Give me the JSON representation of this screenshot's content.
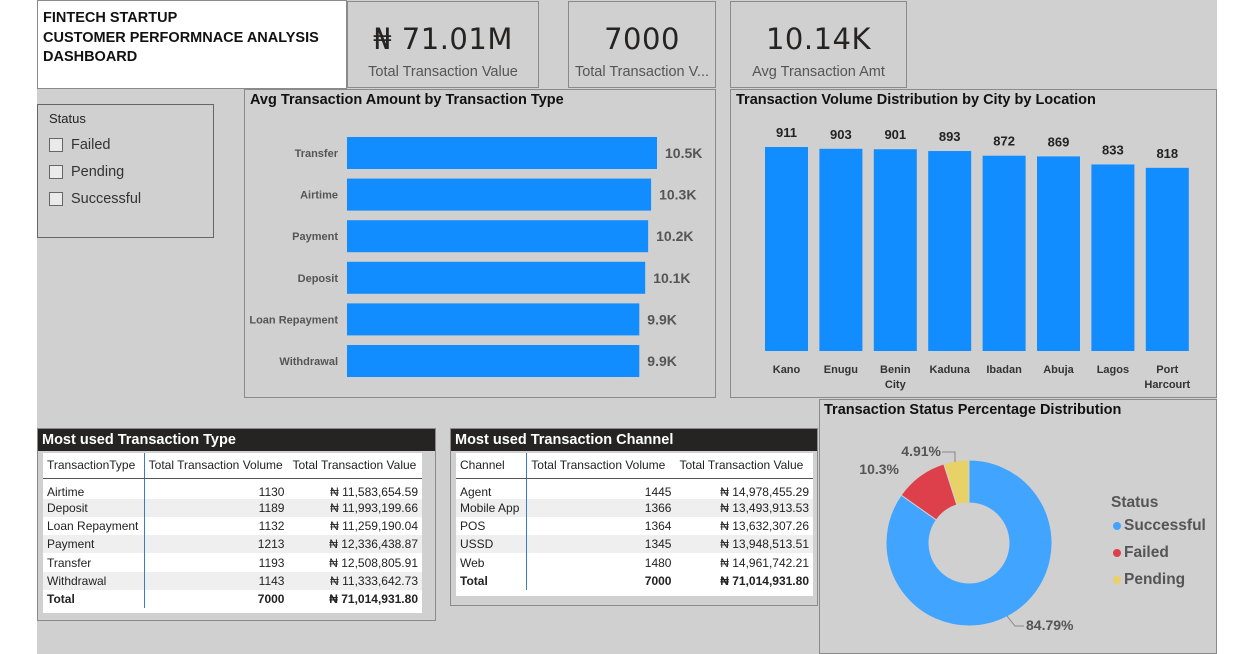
{
  "header": {
    "title_line1": "FINTECH STARTUP",
    "title_line2": "CUSTOMER  PERFORMNACE ANALYSIS",
    "title_line3": "DASHBOARD"
  },
  "cards": [
    {
      "value": "₦ 71.01M",
      "label": "Total Transaction Value"
    },
    {
      "value": "7000",
      "label": "Total Transaction V..."
    },
    {
      "value": "10.14K",
      "label": "Avg Transaction Amt"
    }
  ],
  "slicer": {
    "title": "Status",
    "options": [
      "Failed",
      "Pending",
      "Successful"
    ]
  },
  "chart_data": [
    {
      "type": "bar",
      "orientation": "horizontal",
      "title": "Avg Transaction Amount by Transaction Type",
      "categories": [
        "Transfer",
        "Airtime",
        "Payment",
        "Deposit",
        "Loan Repayment",
        "Withdrawal"
      ],
      "values": [
        10500,
        10300,
        10200,
        10100,
        9900,
        9900
      ],
      "data_labels": [
        "10.5K",
        "10.3K",
        "10.2K",
        "10.1K",
        "9.9K",
        "9.9K"
      ],
      "color": "#118DFF"
    },
    {
      "type": "bar",
      "title": "Transaction Volume Distribution by City by Location",
      "categories": [
        "Kano",
        "Enugu",
        "Benin City",
        "Kaduna",
        "Ibadan",
        "Abuja",
        "Lagos",
        "Port Harcourt"
      ],
      "category_lines": [
        [
          "Kano"
        ],
        [
          "Enugu"
        ],
        [
          "Benin",
          "City"
        ],
        [
          "Kaduna"
        ],
        [
          "Ibadan"
        ],
        [
          "Abuja"
        ],
        [
          "Lagos"
        ],
        [
          "Port",
          "Harcourt"
        ]
      ],
      "values": [
        911,
        903,
        901,
        893,
        872,
        869,
        833,
        818
      ],
      "data_labels": [
        "911",
        "903",
        "901",
        "893",
        "872",
        "869",
        "833",
        "818"
      ],
      "color": "#118DFF"
    },
    {
      "type": "pie",
      "donut": true,
      "title": "Transaction Status Percentage Distribution",
      "legend_title": "Status",
      "legend_position": "right",
      "categories": [
        "Successful",
        "Failed",
        "Pending"
      ],
      "values": [
        84.79,
        10.3,
        4.91
      ],
      "data_labels": [
        "84.79%",
        "10.3%",
        "4.91%"
      ],
      "colors": [
        "#41A4FF",
        "#DD3F4B",
        "#E8D166"
      ]
    }
  ],
  "type_table": {
    "heading": "Most used Transaction Type",
    "columns": [
      "TransactionType",
      "Total Transaction Volume",
      "Total Transaction Value"
    ],
    "rows": [
      [
        "Airtime",
        "1130",
        "₦ 11,583,654.59"
      ],
      [
        "Deposit",
        "1189",
        "₦ 11,993,199.66"
      ],
      [
        "Loan Repayment",
        "1132",
        "₦ 11,259,190.04"
      ],
      [
        "Payment",
        "1213",
        "₦ 12,336,438.87"
      ],
      [
        "Transfer",
        "1193",
        "₦ 12,508,805.91"
      ],
      [
        "Withdrawal",
        "1143",
        "₦ 11,333,642.73"
      ]
    ],
    "total": [
      "Total",
      "7000",
      "₦ 71,014,931.80"
    ]
  },
  "channel_table": {
    "heading": "Most used Transaction Channel",
    "columns": [
      "Channel",
      "Total Transaction Volume",
      "Total Transaction Value"
    ],
    "rows": [
      [
        "Agent",
        "1445",
        "₦ 14,978,455.29"
      ],
      [
        "Mobile App",
        "1366",
        "₦ 13,493,913.53"
      ],
      [
        "POS",
        "1364",
        "₦ 13,632,307.26"
      ],
      [
        "USSD",
        "1345",
        "₦ 13,948,513.51"
      ],
      [
        "Web",
        "1480",
        "₦ 14,961,742.21"
      ]
    ],
    "total": [
      "Total",
      "7000",
      "₦ 71,014,931.80"
    ]
  }
}
